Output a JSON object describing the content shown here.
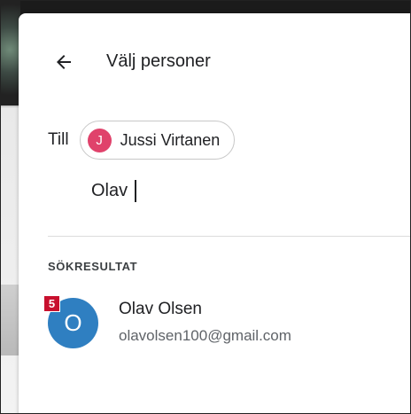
{
  "dialog": {
    "title": "Välj personer",
    "back_icon": "arrow-left-icon"
  },
  "recipients": {
    "label": "Till",
    "chips": [
      {
        "initial": "J",
        "name": "Jussi Virtanen",
        "color": "#e0426b"
      }
    ]
  },
  "search": {
    "value": "Olav"
  },
  "results": {
    "section_label": "SÖKRESULTAT",
    "items": [
      {
        "initial": "O",
        "name": "Olav Olsen",
        "email": "olavolsen100@gmail.com",
        "color": "#2f7fc1",
        "step_badge": "5"
      }
    ]
  },
  "colors": {
    "badge": "#c8102e"
  }
}
